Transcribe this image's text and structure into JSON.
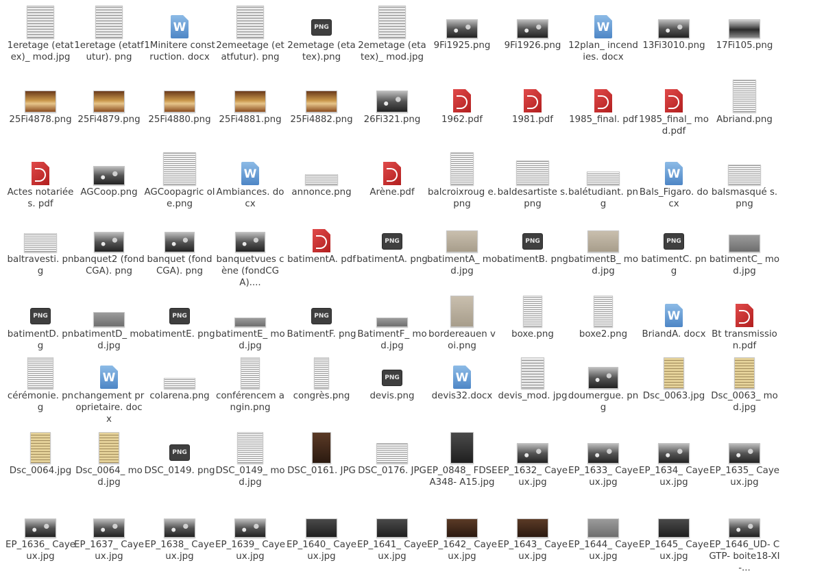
{
  "window": {
    "title": "File manager - icon view"
  },
  "colors": {
    "background": "#ffffff",
    "label_text": "#3c3c3c"
  },
  "files": [
    {
      "name": "1eretage (etatex)_ mod.jpg",
      "kind": "thumb",
      "style": "t-paper",
      "tw": 40,
      "th": 48
    },
    {
      "name": "1eretage (etatfutur). png",
      "kind": "thumb",
      "style": "t-paper",
      "tw": 40,
      "th": 48
    },
    {
      "name": "1Minitere construction. docx",
      "kind": "docx"
    },
    {
      "name": "2emeetage (etatfutur). png",
      "kind": "thumb",
      "style": "t-paper",
      "tw": 40,
      "th": 48
    },
    {
      "name": "2emetage (etatex).png",
      "kind": "png"
    },
    {
      "name": "2emetage (etatex)_ mod.jpg",
      "kind": "thumb",
      "style": "t-paper",
      "tw": 40,
      "th": 48
    },
    {
      "name": "9Fi1925.png",
      "kind": "thumb",
      "style": "t-crowd",
      "tw": 46,
      "th": 28
    },
    {
      "name": "9Fi1926.png",
      "kind": "thumb",
      "style": "t-crowd",
      "tw": 46,
      "th": 28
    },
    {
      "name": "12plan_ incendies. docx",
      "kind": "docx"
    },
    {
      "name": "13Fi3010.png",
      "kind": "thumb",
      "style": "t-crowd",
      "tw": 46,
      "th": 28
    },
    {
      "name": "17Fi105.png",
      "kind": "thumb",
      "style": "t-bw",
      "tw": 46,
      "th": 28
    },
    {
      "name": "25Fi4878.png",
      "kind": "thumb",
      "style": "t-warm",
      "tw": 46,
      "th": 32
    },
    {
      "name": "25Fi4879.png",
      "kind": "thumb",
      "style": "t-warm",
      "tw": 46,
      "th": 32
    },
    {
      "name": "25Fi4880.png",
      "kind": "thumb",
      "style": "t-warm",
      "tw": 46,
      "th": 32
    },
    {
      "name": "25Fi4881.png",
      "kind": "thumb",
      "style": "t-warm",
      "tw": 46,
      "th": 32
    },
    {
      "name": "25Fi4882.png",
      "kind": "thumb",
      "style": "t-warm",
      "tw": 46,
      "th": 32
    },
    {
      "name": "26Fi321.png",
      "kind": "thumb",
      "style": "t-crowd",
      "tw": 46,
      "th": 32
    },
    {
      "name": "1962.pdf",
      "kind": "pdf"
    },
    {
      "name": "1981.pdf",
      "kind": "pdf"
    },
    {
      "name": "1985_final. pdf",
      "kind": "pdf"
    },
    {
      "name": "1985_final_ mod.pdf",
      "kind": "pdf"
    },
    {
      "name": "Abriand.png",
      "kind": "thumb",
      "style": "t-doc",
      "tw": 34,
      "th": 48
    },
    {
      "name": "Actes notariées. pdf",
      "kind": "pdf"
    },
    {
      "name": "AGCoop.png",
      "kind": "thumb",
      "style": "t-crowd",
      "tw": 46,
      "th": 28
    },
    {
      "name": "AGCoopagric ole.png",
      "kind": "thumb",
      "style": "t-doc",
      "tw": 48,
      "th": 48
    },
    {
      "name": "Ambiances. docx",
      "kind": "docx"
    },
    {
      "name": "annonce.png",
      "kind": "thumb",
      "style": "t-doc",
      "tw": 48,
      "th": 16
    },
    {
      "name": "Arène.pdf",
      "kind": "pdf"
    },
    {
      "name": "balcroixroug e.png",
      "kind": "thumb",
      "style": "t-doc",
      "tw": 34,
      "th": 48
    },
    {
      "name": "baldesartiste s.png",
      "kind": "thumb",
      "style": "t-doc",
      "tw": 48,
      "th": 36
    },
    {
      "name": "balétudiant. png",
      "kind": "thumb",
      "style": "t-doc",
      "tw": 48,
      "th": 20
    },
    {
      "name": "Bals_Figaro. docx",
      "kind": "docx"
    },
    {
      "name": "balsmasqué s.png",
      "kind": "thumb",
      "style": "t-doc",
      "tw": 48,
      "th": 30
    },
    {
      "name": "baltravesti. png",
      "kind": "thumb",
      "style": "t-doc",
      "tw": 48,
      "th": 28
    },
    {
      "name": "banquet2 (fondCGA). png",
      "kind": "thumb",
      "style": "t-crowd",
      "tw": 44,
      "th": 30
    },
    {
      "name": "banquet (fondCGA). png",
      "kind": "thumb",
      "style": "t-crowd",
      "tw": 44,
      "th": 30
    },
    {
      "name": "banquetvues cène (fondCGA)....",
      "kind": "thumb",
      "style": "t-crowd",
      "tw": 44,
      "th": 30
    },
    {
      "name": "batimentA. pdf",
      "kind": "pdf"
    },
    {
      "name": "batimentA. png",
      "kind": "png"
    },
    {
      "name": "batimentA_ mod.jpg",
      "kind": "thumb",
      "style": "t-beige",
      "tw": 46,
      "th": 32
    },
    {
      "name": "batimentB. png",
      "kind": "png"
    },
    {
      "name": "batimentB_ mod.jpg",
      "kind": "thumb",
      "style": "t-beige",
      "tw": 46,
      "th": 32
    },
    {
      "name": "batimentC. png",
      "kind": "png"
    },
    {
      "name": "batimentC_ mod.jpg",
      "kind": "thumb",
      "style": "t-grey",
      "tw": 46,
      "th": 26
    },
    {
      "name": "batimentD. png",
      "kind": "png"
    },
    {
      "name": "batimentD_ mod.jpg",
      "kind": "thumb",
      "style": "t-grey",
      "tw": 46,
      "th": 22
    },
    {
      "name": "batimentE. png",
      "kind": "png"
    },
    {
      "name": "batimentE_ mod.jpg",
      "kind": "thumb",
      "style": "t-grey",
      "tw": 46,
      "th": 14
    },
    {
      "name": "BatimentF. png",
      "kind": "png"
    },
    {
      "name": "BatimentF_ mod.jpg",
      "kind": "thumb",
      "style": "t-grey",
      "tw": 46,
      "th": 14
    },
    {
      "name": "bordereauen voi.png",
      "kind": "thumb",
      "style": "t-beige",
      "tw": 34,
      "th": 46
    },
    {
      "name": "boxe.png",
      "kind": "thumb",
      "style": "t-doc",
      "tw": 28,
      "th": 46
    },
    {
      "name": "boxe2.png",
      "kind": "thumb",
      "style": "t-doc",
      "tw": 28,
      "th": 46
    },
    {
      "name": "BriandA. docx",
      "kind": "docx"
    },
    {
      "name": "Bt transmissio n.pdf",
      "kind": "pdf"
    },
    {
      "name": "cérémonie. png",
      "kind": "thumb",
      "style": "t-doc",
      "tw": 38,
      "th": 46
    },
    {
      "name": "changement proprietaire. docx",
      "kind": "docx"
    },
    {
      "name": "colarena.png",
      "kind": "thumb",
      "style": "t-doc",
      "tw": 46,
      "th": 16
    },
    {
      "name": "conférencem angin.png",
      "kind": "thumb",
      "style": "t-doc",
      "tw": 28,
      "th": 46
    },
    {
      "name": "congrès.png",
      "kind": "thumb",
      "style": "t-doc",
      "tw": 22,
      "th": 46
    },
    {
      "name": "devis.png",
      "kind": "png"
    },
    {
      "name": "devis32.docx",
      "kind": "docx"
    },
    {
      "name": "devis_mod. jpg",
      "kind": "thumb",
      "style": "t-paper",
      "tw": 34,
      "th": 46
    },
    {
      "name": "doumergue. png",
      "kind": "thumb",
      "style": "t-crowd",
      "tw": 44,
      "th": 32
    },
    {
      "name": "Dsc_0063.jpg",
      "kind": "thumb",
      "style": "t-yellow",
      "tw": 30,
      "th": 46
    },
    {
      "name": "Dsc_0063_ mod.jpg",
      "kind": "thumb",
      "style": "t-yellow",
      "tw": 30,
      "th": 46
    },
    {
      "name": "Dsc_0064.jpg",
      "kind": "thumb",
      "style": "t-yellow",
      "tw": 30,
      "th": 46
    },
    {
      "name": "Dsc_0064_ mod.jpg",
      "kind": "thumb",
      "style": "t-yellow",
      "tw": 30,
      "th": 46
    },
    {
      "name": "DSC_0149. png",
      "kind": "png"
    },
    {
      "name": "DSC_0149_ mod.jpg",
      "kind": "thumb",
      "style": "t-doc",
      "tw": 38,
      "th": 46
    },
    {
      "name": "DSC_0161. JPG",
      "kind": "thumb",
      "style": "t-brown",
      "tw": 28,
      "th": 46
    },
    {
      "name": "DSC_0176. JPG",
      "kind": "thumb",
      "style": "t-doc",
      "tw": 46,
      "th": 30
    },
    {
      "name": "EP_0848_ FDSEA348- A15.jpg",
      "kind": "thumb",
      "style": "t-dark",
      "tw": 34,
      "th": 46
    },
    {
      "name": "EP_1632_ Cayeux.jpg",
      "kind": "thumb",
      "style": "t-crowd",
      "tw": 46,
      "th": 30
    },
    {
      "name": "EP_1633_ Cayeux.jpg",
      "kind": "thumb",
      "style": "t-crowd",
      "tw": 46,
      "th": 30
    },
    {
      "name": "EP_1634_ Cayeux.jpg",
      "kind": "thumb",
      "style": "t-crowd",
      "tw": 46,
      "th": 30
    },
    {
      "name": "EP_1635_ Cayeux.jpg",
      "kind": "thumb",
      "style": "t-crowd",
      "tw": 46,
      "th": 30
    },
    {
      "name": "EP_1636_ Cayeux.jpg",
      "kind": "thumb",
      "style": "t-crowd",
      "tw": 46,
      "th": 28
    },
    {
      "name": "EP_1637_ Cayeux.jpg",
      "kind": "thumb",
      "style": "t-crowd",
      "tw": 46,
      "th": 28
    },
    {
      "name": "EP_1638_ Cayeux.jpg",
      "kind": "thumb",
      "style": "t-crowd",
      "tw": 46,
      "th": 28
    },
    {
      "name": "EP_1639_ Cayeux.jpg",
      "kind": "thumb",
      "style": "t-crowd",
      "tw": 46,
      "th": 28
    },
    {
      "name": "EP_1640_ Cayeux.jpg",
      "kind": "thumb",
      "style": "t-dark",
      "tw": 46,
      "th": 28
    },
    {
      "name": "EP_1641_ Cayeux.jpg",
      "kind": "thumb",
      "style": "t-dark",
      "tw": 46,
      "th": 28
    },
    {
      "name": "EP_1642_ Cayeux.jpg",
      "kind": "thumb",
      "style": "t-brown",
      "tw": 46,
      "th": 28
    },
    {
      "name": "EP_1643_ Cayeux.jpg",
      "kind": "thumb",
      "style": "t-brown",
      "tw": 46,
      "th": 28
    },
    {
      "name": "EP_1644_ Cayeux.jpg",
      "kind": "thumb",
      "style": "t-grey",
      "tw": 46,
      "th": 28
    },
    {
      "name": "EP_1645_ Cayeux.jpg",
      "kind": "thumb",
      "style": "t-dark",
      "tw": 46,
      "th": 28
    },
    {
      "name": "EP_1646_UD- CGTP- boite18-XI-...",
      "kind": "thumb",
      "style": "t-crowd",
      "tw": 46,
      "th": 28
    }
  ]
}
